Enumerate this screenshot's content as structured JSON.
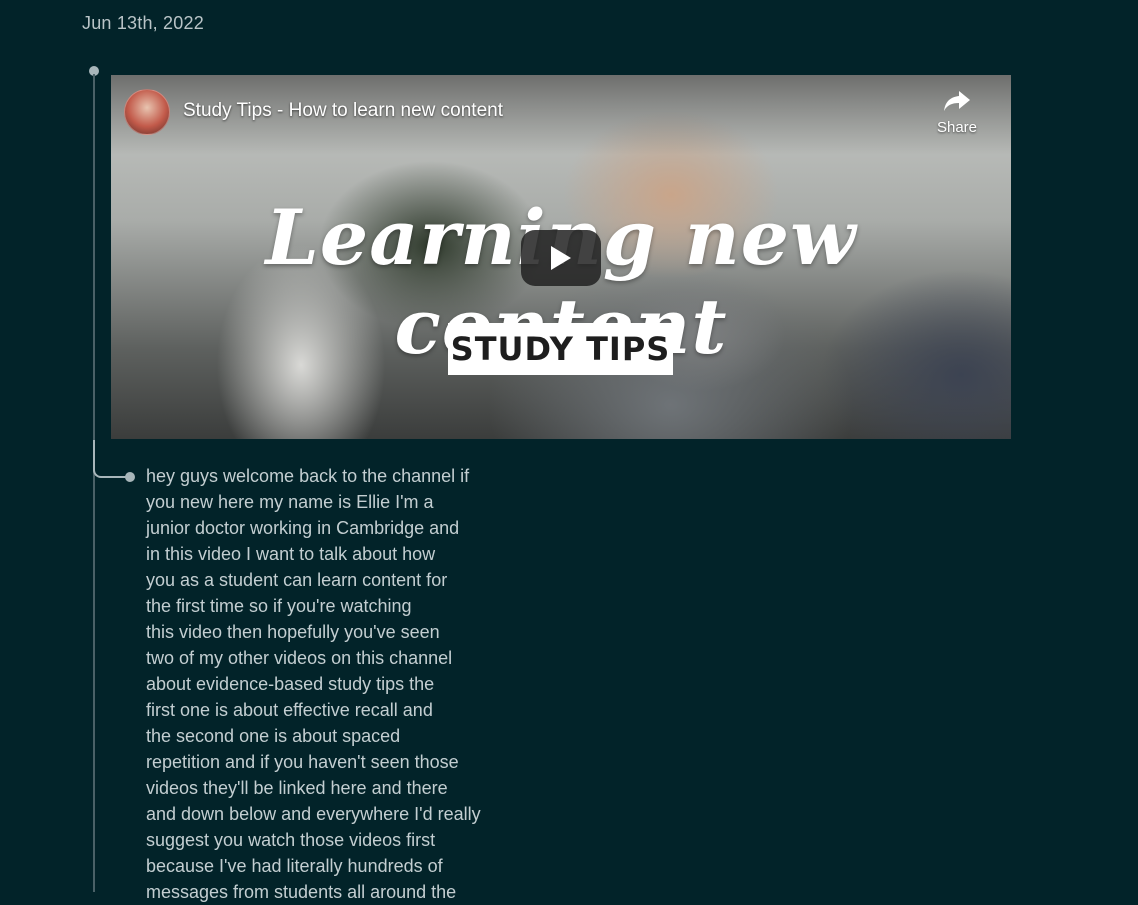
{
  "page": {
    "date_heading": "Jun 13th, 2022"
  },
  "video": {
    "title": "Study Tips - How to learn new content",
    "share_label": "Share",
    "overlay_title": "Learning new content",
    "overlay_badge": "STUDY TIPS"
  },
  "transcript": {
    "lines": [
      "hey guys welcome back to the channel if",
      "you new here my name is Ellie I'm a",
      "junior doctor working in Cambridge and",
      "in this video I want to talk about how",
      "you as a student can learn content for",
      "the first time so if you're watching",
      "this video then hopefully you've seen",
      "two of my other videos on this channel",
      "about evidence-based study tips the",
      "first one is about effective recall and",
      "the second one is about spaced",
      "repetition and if you haven't seen those",
      "videos they'll be linked here and there",
      "and down below and everywhere I'd really",
      "suggest you watch those videos first",
      "because I've had literally hundreds of",
      "messages from students all around the"
    ]
  },
  "colors": {
    "background": "#022329",
    "text": "#c3ced1",
    "rail": "#a8b6ba"
  },
  "icons": {
    "share": "share-arrow-icon",
    "play": "play-icon",
    "bullet": "bullet-dot-icon"
  }
}
